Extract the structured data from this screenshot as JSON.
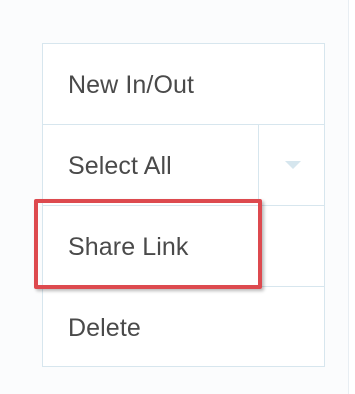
{
  "menu": {
    "items": [
      {
        "label": "New In/Out"
      },
      {
        "label": "Select All",
        "has_dropdown": true
      },
      {
        "label": "Share Link",
        "highlighted": true
      },
      {
        "label": "Delete"
      }
    ]
  },
  "colors": {
    "border": "#d7e6ee",
    "text": "#4a4a4a",
    "highlight": "#dd4a4f",
    "chevron": "#d6e6ee"
  },
  "icons": {
    "dropdown": "chevron-down-icon"
  }
}
